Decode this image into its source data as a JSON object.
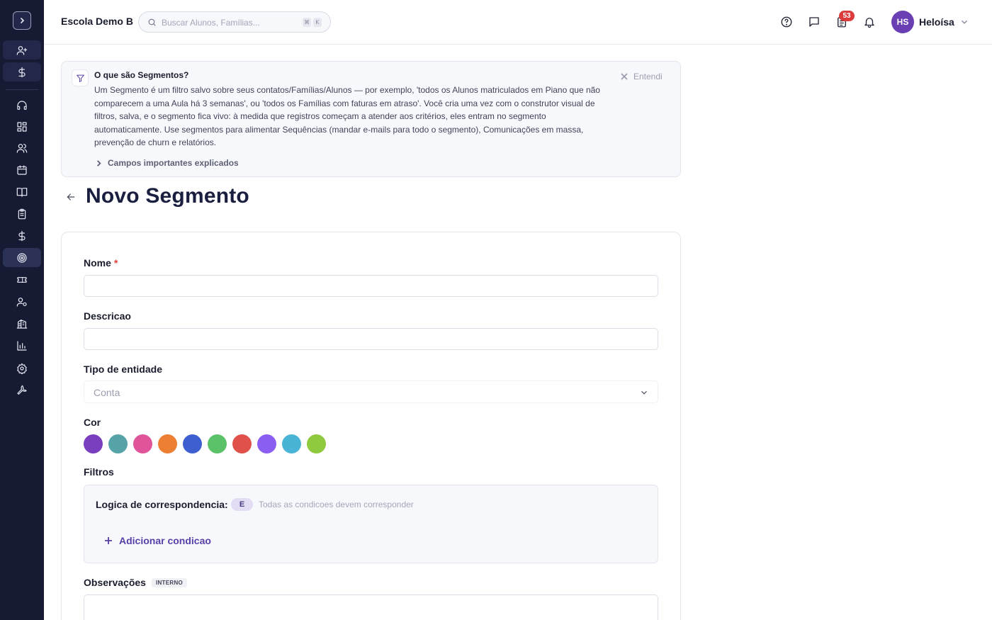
{
  "app": {
    "school_name": "Escola Demo B",
    "search_placeholder": "Buscar Alunos, Famílias...",
    "search_shortcut": [
      "⌘",
      "K"
    ],
    "tasks_badge": "53",
    "user": {
      "initials": "HS",
      "name": "Heloísa"
    }
  },
  "sidebar": {
    "items": [
      {
        "icon": "user-plus-icon"
      },
      {
        "icon": "dollar-icon"
      },
      {
        "icon": "headset-icon"
      },
      {
        "icon": "dashboard-grid-icon"
      },
      {
        "icon": "users-icon"
      },
      {
        "icon": "calendar-icon"
      },
      {
        "icon": "book-open-icon"
      },
      {
        "icon": "clipboard-icon"
      },
      {
        "icon": "billing-dollar-icon"
      },
      {
        "icon": "target-icon",
        "active": true
      },
      {
        "icon": "ticket-icon"
      },
      {
        "icon": "user-settings-icon"
      },
      {
        "icon": "building-icon"
      },
      {
        "icon": "bar-chart-icon"
      },
      {
        "icon": "gear-icon"
      },
      {
        "icon": "wrench-icon"
      }
    ]
  },
  "info": {
    "title": "O que são Segmentos?",
    "body": "Um Segmento é um filtro salvo sobre seus contatos/Famílias/Alunos — por exemplo, 'todos os Alunos matriculados em Piano que não comparecem a uma Aula há 3 semanas', ou 'todos os Famílias com faturas em atraso'. Você cria uma vez com o construtor visual de filtros, salva, e o segmento fica vivo: à medida que registros começam a atender aos critérios, eles entram no segmento automaticamente. Use segmentos para alimentar Sequências (mandar e-mails para todo o segmento), Comunicações em massa, prevenção de churn e relatórios.",
    "dismiss_label": "Entendi",
    "expand_label": "Campos importantes explicados"
  },
  "page": {
    "title": "Novo Segmento"
  },
  "form": {
    "name_label": "Nome",
    "required_mark": "*",
    "name_value": "",
    "description_label": "Descricao",
    "description_value": "",
    "entity_label": "Tipo de entidade",
    "entity_value": "Conta",
    "color_label": "Cor",
    "colors": [
      "#7a3fbf",
      "#56a3a8",
      "#e0549a",
      "#ec7f32",
      "#3e5fcf",
      "#5cc26a",
      "#e0514b",
      "#8a5ef0",
      "#4ab4d6",
      "#8fc93e"
    ],
    "filters_label": "Filtros",
    "match_label": "Logica de correspondencia:",
    "match_value": "E",
    "match_hint": "Todas as condicoes devem corresponder",
    "add_condition_label": "Adicionar condicao",
    "notes_label": "Observações",
    "notes_tag": "INTERNO",
    "notes_value": ""
  }
}
